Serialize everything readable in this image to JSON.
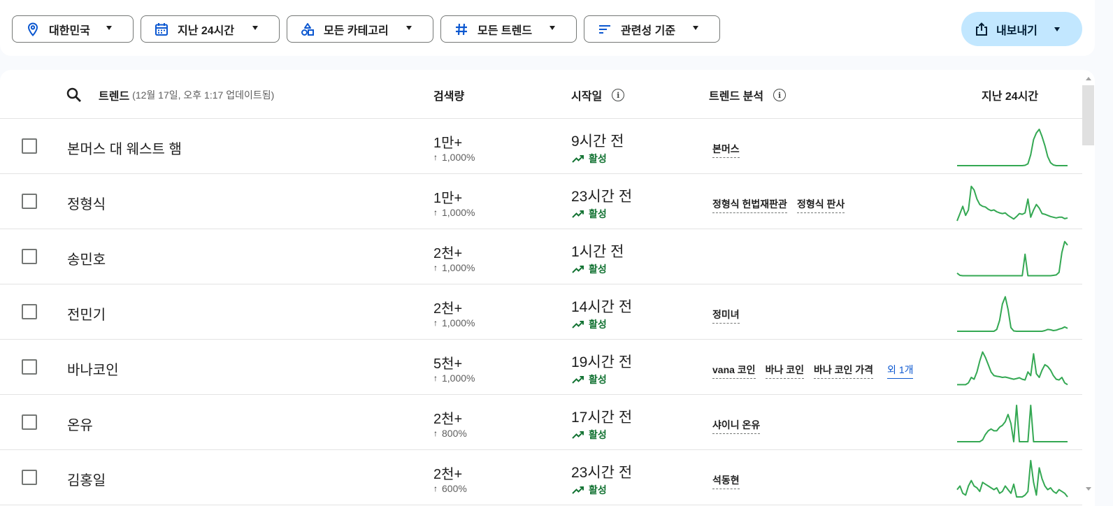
{
  "filters": {
    "region": {
      "label": "대한민국",
      "icon": "location-pin-icon"
    },
    "time": {
      "label": "지난 24시간",
      "icon": "calendar-icon"
    },
    "category": {
      "label": "모든 카테고리",
      "icon": "category-shapes-icon"
    },
    "trend_type": {
      "label": "모든 트렌드",
      "icon": "hashtag-icon"
    },
    "sort": {
      "label": "관련성 기준",
      "icon": "sort-lines-icon"
    },
    "export": {
      "label": "내보내기",
      "icon": "share-export-icon"
    }
  },
  "table": {
    "headers": {
      "trend": "트렌드",
      "trend_sub": "(12월 17일, 오후 1:17 업데이트됨)",
      "volume": "검색량",
      "started": "시작일",
      "breakdown": "트렌드 분석",
      "chart": "지난 24시간"
    },
    "rows": [
      {
        "name": "본머스 대 웨스트 햄",
        "volume": "1만+",
        "pct": "1,000%",
        "started": "9시간 전",
        "status": "활성",
        "breakdown": [
          "본머스"
        ],
        "more": "",
        "spark": [
          0,
          0,
          0,
          0,
          0,
          0,
          0,
          0,
          0,
          0,
          0,
          0,
          0,
          0,
          0,
          0,
          0,
          0,
          0,
          0,
          0,
          0,
          0,
          0,
          1,
          5,
          30,
          72,
          90,
          100,
          80,
          55,
          25,
          8,
          2,
          0,
          0,
          0,
          0,
          0
        ]
      },
      {
        "name": "정형식",
        "volume": "1만+",
        "pct": "1,000%",
        "started": "23시간 전",
        "status": "활성",
        "breakdown": [
          "정형식 헌법재판관",
          "정형식 판사"
        ],
        "more": "",
        "spark": [
          0,
          20,
          40,
          15,
          30,
          95,
          85,
          60,
          45,
          40,
          38,
          32,
          28,
          30,
          25,
          22,
          20,
          22,
          15,
          10,
          5,
          12,
          20,
          18,
          22,
          60,
          10,
          30,
          45,
          35,
          20,
          18,
          15,
          12,
          10,
          8,
          10,
          10,
          6,
          8
        ]
      },
      {
        "name": "송민호",
        "volume": "2천+",
        "pct": "1,000%",
        "started": "1시간 전",
        "status": "활성",
        "breakdown": [],
        "more": "",
        "spark": [
          8,
          2,
          1,
          1,
          1,
          1,
          1,
          1,
          1,
          1,
          1,
          1,
          1,
          1,
          1,
          1,
          1,
          1,
          1,
          1,
          1,
          1,
          1,
          1,
          60,
          1,
          1,
          1,
          1,
          1,
          1,
          1,
          1,
          1,
          2,
          3,
          10,
          65,
          95,
          85
        ]
      },
      {
        "name": "전민기",
        "volume": "2천+",
        "pct": "1,000%",
        "started": "14시간 전",
        "status": "활성",
        "breakdown": [
          "정미녀"
        ],
        "more": "",
        "spark": [
          0,
          0,
          0,
          0,
          0,
          0,
          0,
          0,
          0,
          0,
          0,
          0,
          0,
          0,
          5,
          30,
          75,
          95,
          60,
          10,
          1,
          0,
          0,
          0,
          0,
          0,
          0,
          0,
          0,
          0,
          0,
          2,
          5,
          4,
          2,
          3,
          6,
          8,
          12,
          8
        ]
      },
      {
        "name": "바나코인",
        "volume": "5천+",
        "pct": "1,000%",
        "started": "19시간 전",
        "status": "활성",
        "breakdown": [
          "vana 코인",
          "바나 코인",
          "바나 코인 가격"
        ],
        "more": "외 1개",
        "spark": [
          5,
          5,
          5,
          5,
          10,
          25,
          20,
          40,
          70,
          95,
          80,
          60,
          40,
          30,
          28,
          27,
          25,
          26,
          24,
          22,
          20,
          22,
          24,
          20,
          18,
          40,
          30,
          90,
          35,
          25,
          45,
          60,
          55,
          45,
          30,
          20,
          18,
          25,
          10,
          5
        ]
      },
      {
        "name": "온유",
        "volume": "2천+",
        "pct": "800%",
        "started": "17시간 전",
        "status": "활성",
        "breakdown": [
          "샤이니 온유"
        ],
        "more": "",
        "spark": [
          0,
          0,
          0,
          0,
          0,
          0,
          0,
          0,
          0,
          5,
          20,
          30,
          35,
          30,
          30,
          40,
          45,
          55,
          75,
          50,
          0,
          100,
          0,
          0,
          0,
          0,
          100,
          0,
          0,
          0,
          0,
          0,
          0,
          0,
          0,
          0,
          0,
          0,
          0,
          0
        ]
      },
      {
        "name": "김홍일",
        "volume": "2천+",
        "pct": "600%",
        "started": "23시간 전",
        "status": "활성",
        "breakdown": [
          "석동현"
        ],
        "more": "",
        "spark": [
          20,
          30,
          10,
          5,
          30,
          45,
          30,
          25,
          15,
          40,
          35,
          30,
          25,
          20,
          25,
          10,
          15,
          30,
          20,
          10,
          35,
          0,
          0,
          0,
          5,
          15,
          100,
          40,
          5,
          80,
          50,
          30,
          20,
          25,
          15,
          10,
          20,
          15,
          10,
          0
        ]
      }
    ]
  },
  "colors": {
    "accent": "#1a73e8",
    "active": "#137333",
    "spark": "#34a853",
    "export_bg": "#c2e7ff"
  }
}
